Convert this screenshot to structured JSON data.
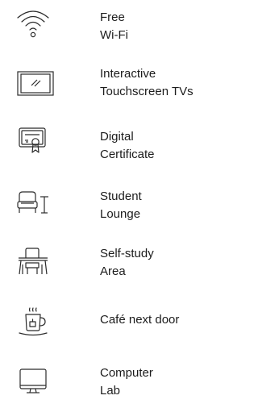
{
  "features": [
    {
      "icon": "wifi-icon",
      "line1": "Free",
      "line2": "Wi-Fi"
    },
    {
      "icon": "tv-icon",
      "line1": "Interactive",
      "line2": "Touchscreen TVs"
    },
    {
      "icon": "certificate-icon",
      "line1": "Digital",
      "line2": "Certificate"
    },
    {
      "icon": "lounge-chair-icon",
      "line1": "Student",
      "line2": "Lounge"
    },
    {
      "icon": "desk-icon",
      "line1": "Self-study",
      "line2": "Area"
    },
    {
      "icon": "coffee-cup-icon",
      "line1": "Café next door"
    },
    {
      "icon": "computer-monitor-icon",
      "line1": "Computer",
      "line2": "Lab"
    }
  ],
  "colors": {
    "icon_stroke": "#2b2b2b",
    "text": "#1c1c1c"
  }
}
